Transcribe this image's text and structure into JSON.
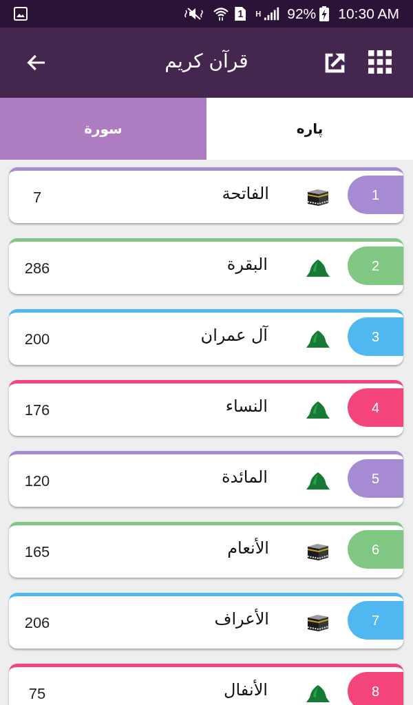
{
  "status_bar": {
    "sim_slot": "1",
    "network_type": "H",
    "battery_percent": "92%",
    "charging": true,
    "time": "10:30 AM"
  },
  "app_bar": {
    "title": "قرآن کریم"
  },
  "tabs": [
    {
      "label": "پاره",
      "selected": false
    },
    {
      "label": "سورة",
      "selected": true
    }
  ],
  "surahs": [
    {
      "number": "1",
      "name": "الفاتحة",
      "kind": "meccan",
      "verses": "7",
      "color": "#a68bd3"
    },
    {
      "number": "2",
      "name": "البقرة",
      "kind": "medinan",
      "verses": "286",
      "color": "#80c783"
    },
    {
      "number": "3",
      "name": "آل عمران",
      "kind": "medinan",
      "verses": "200",
      "color": "#4fb8f1"
    },
    {
      "number": "4",
      "name": "النساء",
      "kind": "medinan",
      "verses": "176",
      "color": "#f4457a"
    },
    {
      "number": "5",
      "name": "المائدة",
      "kind": "medinan",
      "verses": "120",
      "color": "#a68bd3"
    },
    {
      "number": "6",
      "name": "الأنعام",
      "kind": "meccan",
      "verses": "165",
      "color": "#80c783"
    },
    {
      "number": "7",
      "name": "الأعراف",
      "kind": "meccan",
      "verses": "206",
      "color": "#4fb8f1"
    },
    {
      "number": "8",
      "name": "الأنفال",
      "kind": "medinan",
      "verses": "75",
      "color": "#f4457a"
    }
  ]
}
